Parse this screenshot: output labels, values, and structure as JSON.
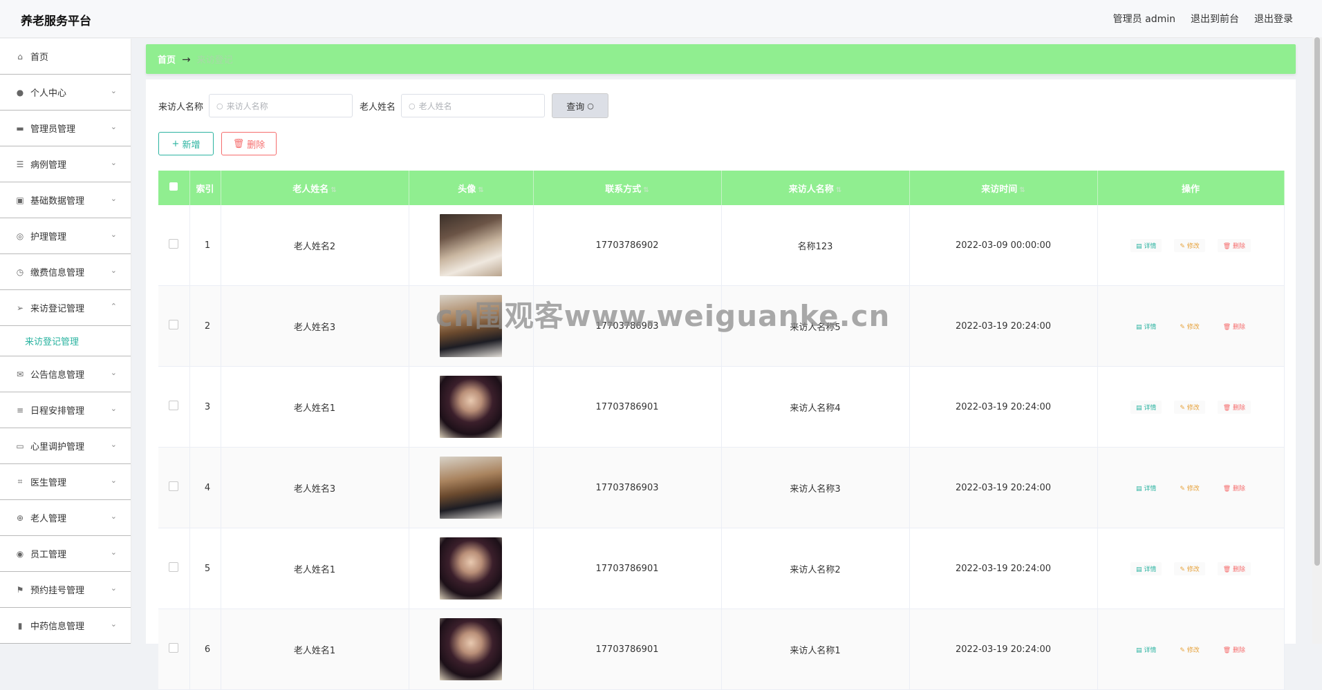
{
  "header": {
    "brand": "养老服务平台",
    "user_label": "管理员 admin",
    "to_front": "退出到前台",
    "logout": "退出登录"
  },
  "sidebar": {
    "items": [
      {
        "label": "首页",
        "icon": "home-icon"
      },
      {
        "label": "个人中心",
        "icon": "user-icon"
      },
      {
        "label": "管理员管理",
        "icon": "briefcase-icon"
      },
      {
        "label": "病例管理",
        "icon": "list-icon"
      },
      {
        "label": "基础数据管理",
        "icon": "clipboard-icon"
      },
      {
        "label": "护理管理",
        "icon": "target-icon"
      },
      {
        "label": "缴费信息管理",
        "icon": "clock-icon"
      },
      {
        "label": "来访登记管理",
        "icon": "send-icon"
      },
      {
        "label": "公告信息管理",
        "icon": "mail-icon"
      },
      {
        "label": "日程安排管理",
        "icon": "menu-icon"
      },
      {
        "label": "心里调护管理",
        "icon": "chat-icon"
      },
      {
        "label": "医生管理",
        "icon": "crop-icon"
      },
      {
        "label": "老人管理",
        "icon": "aim-icon"
      },
      {
        "label": "员工管理",
        "icon": "pin-icon"
      },
      {
        "label": "预约挂号管理",
        "icon": "flag-icon"
      },
      {
        "label": "中药信息管理",
        "icon": "chart-icon"
      }
    ],
    "submenu_label": "来访登记管理"
  },
  "breadcrumb": {
    "home": "首页",
    "current": "来访登记"
  },
  "search": {
    "visitor_label": "来访人名称",
    "visitor_placeholder": "来访人名称",
    "elder_label": "老人姓名",
    "elder_placeholder": "老人姓名",
    "query_button": "查询"
  },
  "actions": {
    "add": "新增",
    "delete": "删除"
  },
  "table": {
    "columns": [
      "索引",
      "老人姓名",
      "头像",
      "联系方式",
      "来访人名称",
      "来访时间",
      "操作"
    ],
    "op_view": "详情",
    "op_edit": "修改",
    "op_remove": "删除",
    "rows": [
      {
        "index": "1",
        "elder": "老人姓名2",
        "phone": "17703786902",
        "visitor": "名称123",
        "time": "2022-03-09 00:00:00"
      },
      {
        "index": "2",
        "elder": "老人姓名3",
        "phone": "17703786903",
        "visitor": "来访人名称5",
        "time": "2022-03-19 20:24:00"
      },
      {
        "index": "3",
        "elder": "老人姓名1",
        "phone": "17703786901",
        "visitor": "来访人名称4",
        "time": "2022-03-19 20:24:00"
      },
      {
        "index": "4",
        "elder": "老人姓名3",
        "phone": "17703786903",
        "visitor": "来访人名称3",
        "time": "2022-03-19 20:24:00"
      },
      {
        "index": "5",
        "elder": "老人姓名1",
        "phone": "17703786901",
        "visitor": "来访人名称2",
        "time": "2022-03-19 20:24:00"
      },
      {
        "index": "6",
        "elder": "老人姓名1",
        "phone": "17703786901",
        "visitor": "来访人名称1",
        "time": "2022-03-19 20:24:00"
      }
    ]
  },
  "watermark": "cn围观客www.weiguanke.cn",
  "colors": {
    "accent": "#90ee90",
    "teal": "#2ab3a0",
    "danger": "#f56c6c",
    "warning": "#e6a23c"
  }
}
